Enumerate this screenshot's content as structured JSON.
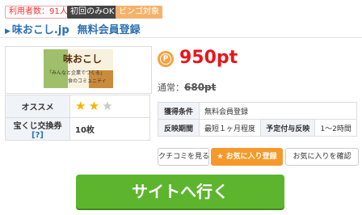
{
  "badges": {
    "users": "利用者数：91人",
    "first_only": "初回のみOK",
    "bingo": "ビンゴ対象"
  },
  "title": {
    "site": "味おこし.jp",
    "subtitle": "無料会員登録"
  },
  "banner": {
    "logo_text": "味おこし",
    "tagline1": "「みんなと企業でつくる」",
    "tagline2": "食のコミュニティ"
  },
  "left_table": {
    "recommend_label": "オススメ",
    "stars": {
      "filled": 2,
      "total": 3
    },
    "lottery_label": "宝くじ交換券",
    "help_link": "?",
    "lottery_value": "10枚"
  },
  "points": {
    "coin_glyph": "P",
    "value": "950pt",
    "normal_label": "通常：",
    "normal_value": "680pt"
  },
  "right_table": {
    "condition_label": "獲得条件",
    "condition_value": "無料会員登録",
    "reflect_period_label": "反映期間",
    "reflect_period_value": "最短１ヶ月程度",
    "scheduled_label": "予定付与反映",
    "scheduled_value": "1〜2時間"
  },
  "buttons": {
    "reviews": "クチコミを見る",
    "favorite_add": "お気に入り登録",
    "favorite_check": "お気に入りを確認",
    "go_site": "サイトへ行く"
  },
  "colors": {
    "accent_blue": "#2a6fb5",
    "point_red": "#e8161b",
    "go_green": "#5cb52d",
    "fav_orange": "#f59a2a",
    "star_gold": "#f5b400"
  }
}
